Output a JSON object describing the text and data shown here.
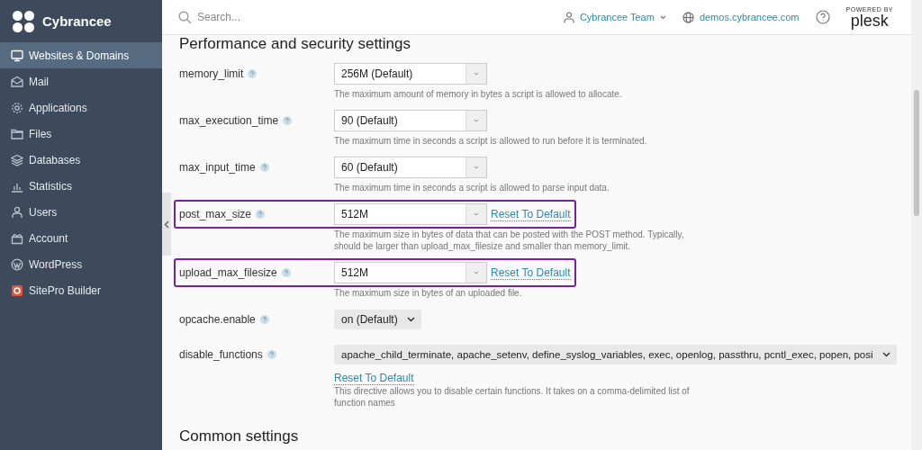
{
  "brand": {
    "name": "Cybrancee"
  },
  "sidebar": {
    "items": [
      {
        "label": "Websites & Domains",
        "selected": true
      },
      {
        "label": "Mail",
        "selected": false
      },
      {
        "label": "Applications",
        "selected": false
      },
      {
        "label": "Files",
        "selected": false
      },
      {
        "label": "Databases",
        "selected": false
      },
      {
        "label": "Statistics",
        "selected": false
      },
      {
        "label": "Users",
        "selected": false
      },
      {
        "label": "Account",
        "selected": false
      },
      {
        "label": "WordPress",
        "selected": false
      },
      {
        "label": "SitePro Builder",
        "selected": false
      }
    ]
  },
  "topbar": {
    "search": {
      "placeholder": "Search..."
    },
    "user": "Cybrancee Team",
    "domain": "demos.cybrancee.com",
    "powered_by": "POWERED BY",
    "product": "plesk"
  },
  "section_title": "Performance and security settings",
  "settings": [
    {
      "name": "memory_limit",
      "kind": "combo",
      "value": "256M (Default)",
      "highlighted": false,
      "hint": "The maximum amount of memory in bytes a script is allowed to allocate."
    },
    {
      "name": "max_execution_time",
      "kind": "combo",
      "value": "90 (Default)",
      "highlighted": false,
      "hint": "The maximum time in seconds a script is allowed to run before it is terminated."
    },
    {
      "name": "max_input_time",
      "kind": "combo",
      "value": "60 (Default)",
      "highlighted": false,
      "hint": "The maximum time in seconds a script is allowed to parse input data."
    },
    {
      "name": "post_max_size",
      "kind": "combo",
      "value": "512M",
      "highlighted": true,
      "reset": "Reset To Default",
      "hint": "The maximum size in bytes of data that can be posted with the POST method. Typically, should be larger than upload_max_filesize and smaller than memory_limit."
    },
    {
      "name": "upload_max_filesize",
      "kind": "combo",
      "value": "512M",
      "highlighted": true,
      "reset": "Reset To Default",
      "hint": "The maximum size in bytes of an uploaded file."
    },
    {
      "name": "opcache.enable",
      "kind": "select",
      "value": "on (Default)",
      "highlighted": false
    },
    {
      "name": "disable_functions",
      "kind": "wide-select",
      "value": "apache_child_terminate, apache_setenv, define_syslog_variables, exec, openlog, passthru, pcntl_exec, popen, posi",
      "highlighted": false,
      "reset": "Reset To Default",
      "hint": "This directive allows you to disable certain functions. It takes on a comma-delimited list of function names"
    }
  ],
  "next_section_title": "Common settings"
}
